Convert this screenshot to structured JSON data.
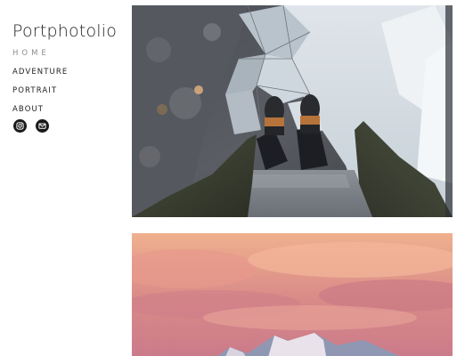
{
  "site": {
    "title": "Portphotolio"
  },
  "nav": {
    "items": [
      {
        "label": "HOME",
        "active": true
      },
      {
        "label": "ADVENTURE",
        "active": false
      },
      {
        "label": "PORTRAIT",
        "active": false
      },
      {
        "label": "ABOUT",
        "active": false
      }
    ]
  },
  "social": {
    "icons": [
      "instagram-icon",
      "mail-icon"
    ]
  },
  "gallery": {
    "photos": [
      {
        "subject": "feet-on-ice-photo"
      },
      {
        "subject": "pink-sky-mountains-photo"
      }
    ]
  },
  "colors": {
    "text": "#222222",
    "nav_active": "#8c8c8c",
    "icon_bg": "#1a1a1a"
  }
}
